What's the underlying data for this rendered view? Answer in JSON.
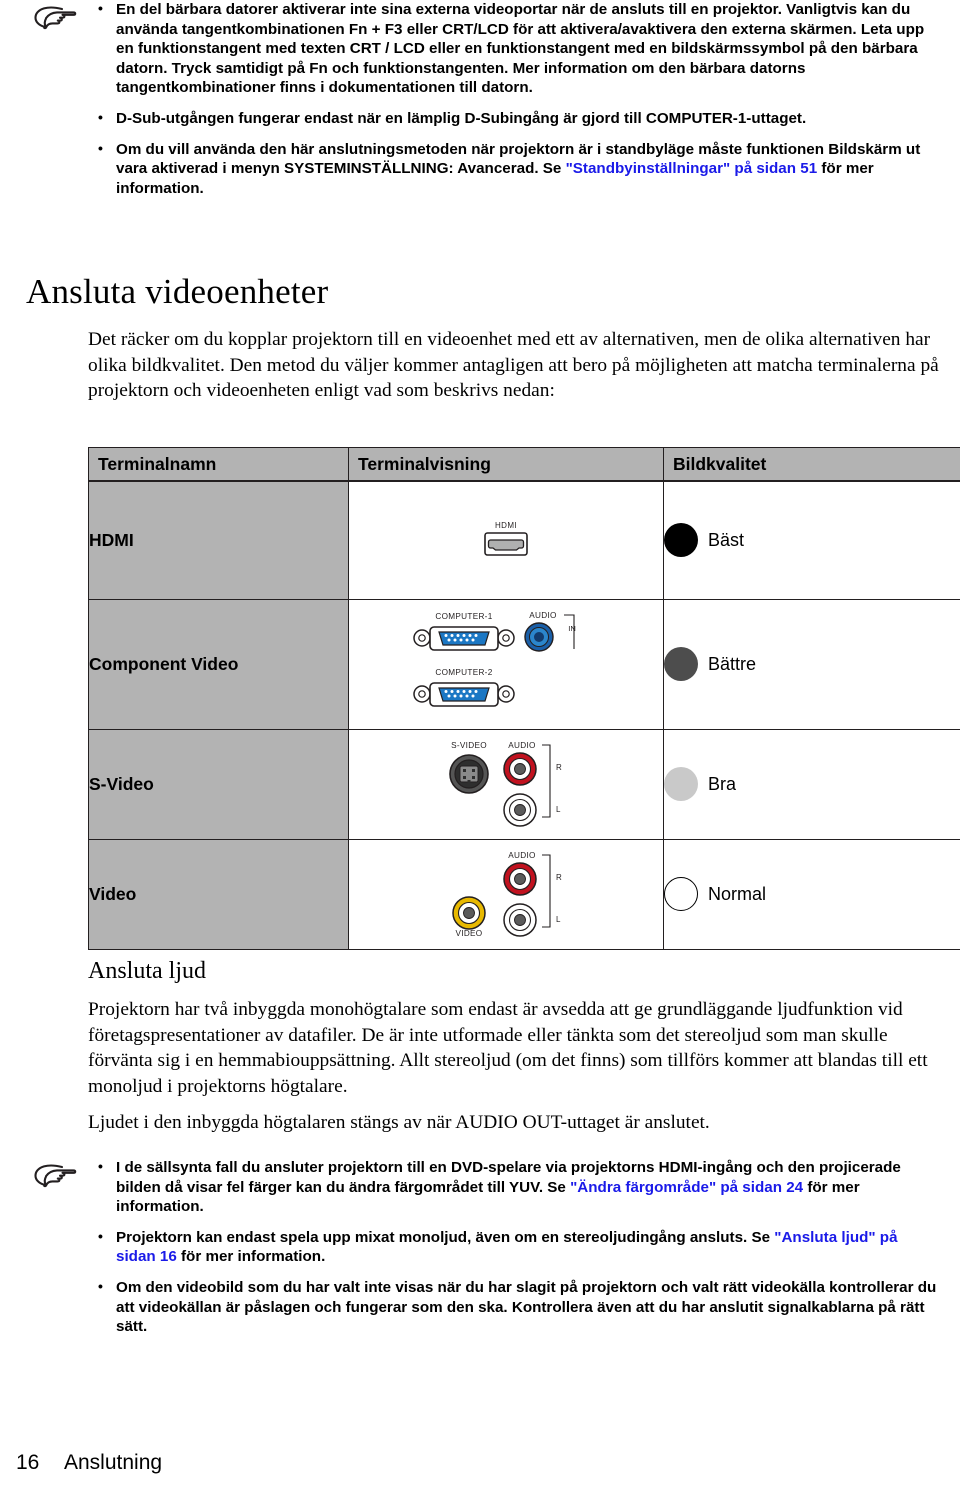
{
  "top_note": {
    "icon": "pointing-hand-icon",
    "items": [
      {
        "text": "En del bärbara datorer aktiverar inte sina externa videoportar när de ansluts till en projektor. Vanligtvis kan du använda tangentkombinationen Fn + F3 eller CRT/LCD för att aktivera/avaktivera den externa skärmen. Leta upp en funktionstangent med texten CRT / LCD eller en funktionstangent med en bildskärmssymbol på den bärbara datorn. Tryck samtidigt på Fn och funktionstangenten. Mer information om den bärbara datorns tangentkombinationer finns i dokumentationen till datorn."
      },
      {
        "text": "D-Sub-utgången fungerar endast när  en lämplig D-Subingång är gjord till COMPUTER-1-uttaget."
      },
      {
        "text_before": "Om du vill använda den här anslutningsmetoden när projektorn är i standbyläge måste funktionen Bildskärm ut vara aktiverad i menyn SYSTEMINSTÄLLNING: Avancerad. Se ",
        "link": "\"Standbyinställningar\" på sidan 51",
        "text_after": " för mer information."
      }
    ]
  },
  "video_section": {
    "heading": "Ansluta videoenheter",
    "intro": "Det räcker om du kopplar projektorn till en videoenhet med ett av alternativen, men de olika alternativen har olika bildkvalitet. Den metod du väljer kommer antagligen att bero på möjligheten att matcha terminalerna på projektorn och videoenheten enligt vad som beskrivs nedan:"
  },
  "terminal_table": {
    "columns": [
      "Terminalnamn",
      "Terminalvisning",
      "Bildkvalitet"
    ],
    "rows": [
      {
        "name": "HDMI",
        "port_labels": [
          "HDMI"
        ],
        "quality_label": "Bäst",
        "quality_level": "best",
        "quality_color": "#000000"
      },
      {
        "name": "Component Video",
        "port_labels": [
          "COMPUTER-1",
          "COMPUTER-2",
          "AUDIO",
          "IN"
        ],
        "quality_label": "Bättre",
        "quality_level": "better",
        "quality_color": "#4d4d4d"
      },
      {
        "name": "S-Video",
        "port_labels": [
          "S-VIDEO",
          "AUDIO",
          "R",
          "L"
        ],
        "quality_label": "Bra",
        "quality_level": "good",
        "quality_color": "#c9c9c9"
      },
      {
        "name": "Video",
        "port_labels": [
          "AUDIO",
          "R",
          "L",
          "VIDEO"
        ],
        "quality_label": "Normal",
        "quality_level": "normal",
        "quality_color": "#ffffff"
      }
    ]
  },
  "audio_section": {
    "heading": "Ansluta ljud",
    "paragraph1": "Projektorn har två inbyggda monohögtalare som endast är avsedda att ge grundläggande ljudfunktion vid företagspresentationer av datafiler. De är inte utformade eller tänkta som det stereoljud som man skulle förvänta sig i en hemmabiouppsättning. Allt stereoljud (om det finns) som tillförs kommer att blandas till ett monoljud i projektorns högtalare.",
    "paragraph2_before": "Ljudet i den inbyggda högtalaren stängs av när ",
    "paragraph2_bold": "AUDIO OUT",
    "paragraph2_after": "-uttaget är anslutet."
  },
  "bottom_note": {
    "icon": "pointing-hand-icon",
    "items": [
      {
        "text_before": "I de sällsynta fall du ansluter projektorn till en DVD-spelare via projektorns HDMI-ingång och den projicerade bilden då visar fel färger kan du ändra färgområdet till YUV. Se ",
        "link": "\"Ändra färgområde\" på sidan 24",
        "text_after": " för mer information."
      },
      {
        "text_before": "Projektorn kan endast spela upp mixat monoljud, även om en stereoljudingång ansluts. Se ",
        "link": "\"Ansluta ljud\" på sidan 16",
        "text_after": " för mer information."
      },
      {
        "text": "Om den videobild som du har valt inte visas när du har slagit på projektorn och valt rätt videokälla kontrollerar du att videokällan är påslagen och fungerar som den ska. Kontrollera även att du har anslutit signalkablarna på rätt sätt."
      }
    ]
  },
  "footer": {
    "page_number": "16",
    "chapter": "Anslutning"
  }
}
